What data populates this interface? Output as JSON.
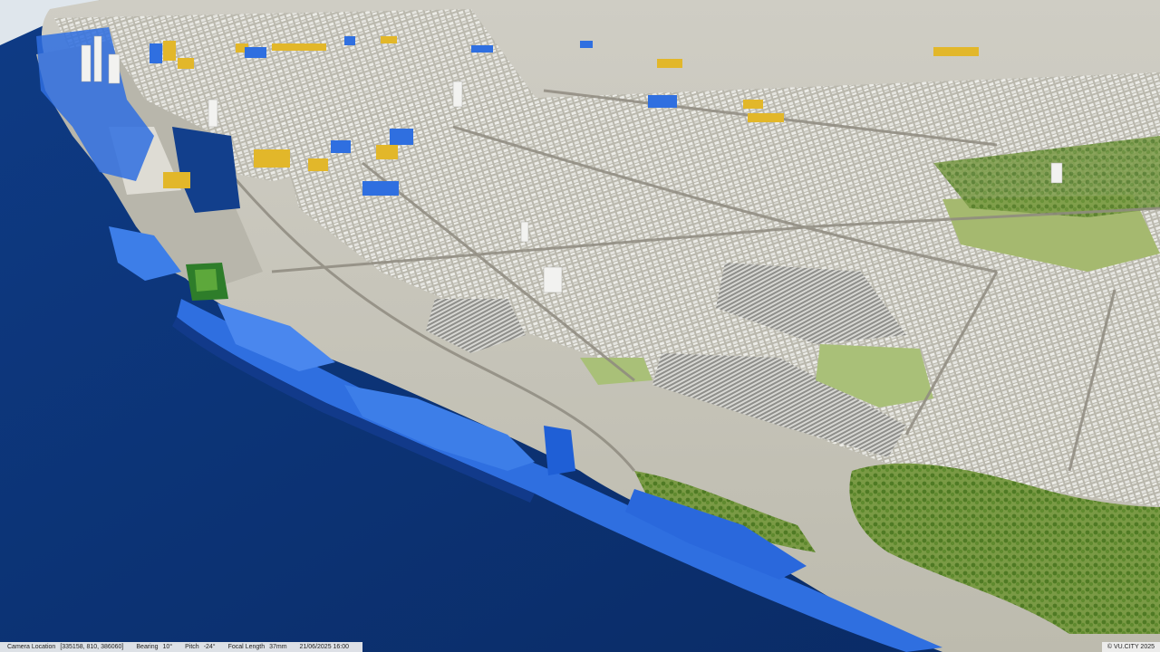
{
  "status": {
    "camera_location_label": "Camera Location",
    "camera_location_value": "[335158, 810, 386060]",
    "bearing_label": "Bearing",
    "bearing_value": "10°",
    "pitch_label": "Pitch",
    "pitch_value": "-24°",
    "focal_length_label": "Focal Length",
    "focal_length_value": "37mm",
    "datetime": "21/06/2025 16:00"
  },
  "copyright": "© VU.CITY 2025",
  "colors": {
    "water": "#0c2f6b",
    "land": "#c9c7bb",
    "park": "#9fb56a",
    "trees": "#5f8a2e",
    "buildings": "#e8e8e6",
    "highlight_blue": "#2f6fe0",
    "highlight_yellow": "#e2b72a",
    "highlight_green": "#2e7d2a"
  }
}
